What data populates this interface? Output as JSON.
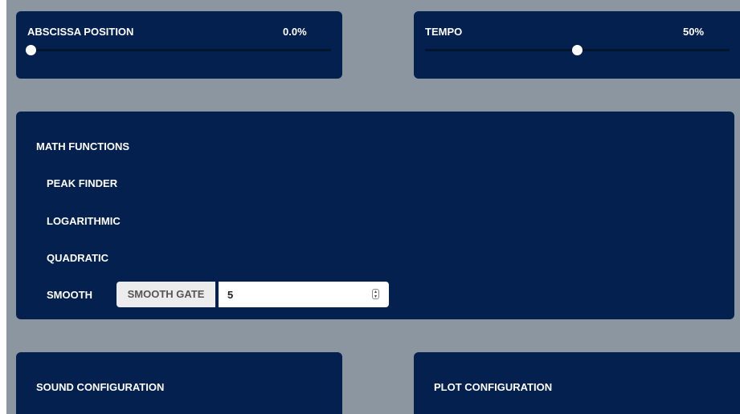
{
  "abscissa": {
    "label": "ABSCISSA POSITION",
    "value_text": "0.0%",
    "value": 0.0
  },
  "tempo": {
    "label": "TEMPO",
    "value_text": "50%",
    "value": 0.5
  },
  "math": {
    "title": "MATH FUNCTIONS",
    "items": [
      "PEAK FINDER",
      "LOGARITHMIC",
      "QUADRATIC"
    ],
    "smooth_label": "SMOOTH",
    "smooth_gate_label": "SMOOTH GATE",
    "smooth_gate_value": "5"
  },
  "sound": {
    "title": "SOUND CONFIGURATION"
  },
  "plot": {
    "title": "PLOT CONFIGURATION"
  },
  "colors": {
    "panel": "#03204f",
    "background": "#8c96a0",
    "track": "#02152f"
  },
  "icons": {
    "spinner": "number-spinner-icon"
  }
}
